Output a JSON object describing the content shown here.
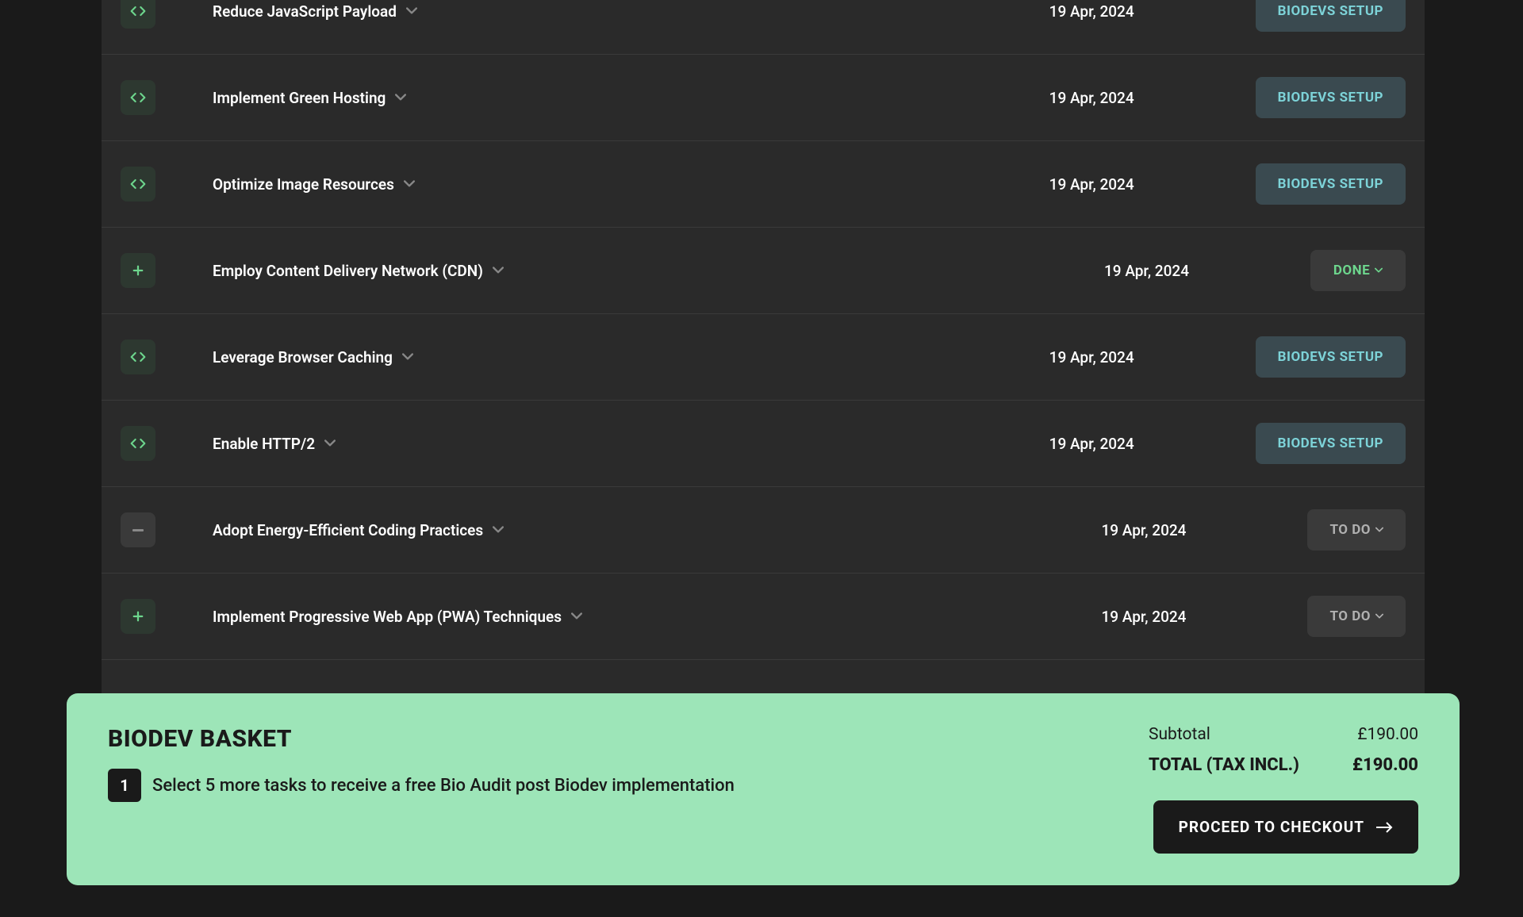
{
  "tasks": [
    {
      "title": "Reduce JavaScript Payload",
      "date": "19 Apr, 2024",
      "status": "BIODEVS SETUP",
      "statusType": "biodev",
      "iconType": "code"
    },
    {
      "title": "Implement Green Hosting",
      "date": "19 Apr, 2024",
      "status": "BIODEVS SETUP",
      "statusType": "biodev",
      "iconType": "code"
    },
    {
      "title": "Optimize Image Resources",
      "date": "19 Apr, 2024",
      "status": "BIODEVS SETUP",
      "statusType": "biodev",
      "iconType": "code"
    },
    {
      "title": "Employ Content Delivery Network (CDN)",
      "date": "19 Apr, 2024",
      "status": "DONE",
      "statusType": "done",
      "iconType": "plus"
    },
    {
      "title": "Leverage Browser Caching",
      "date": "19 Apr, 2024",
      "status": "BIODEVS SETUP",
      "statusType": "biodev",
      "iconType": "code"
    },
    {
      "title": "Enable HTTP/2",
      "date": "19 Apr, 2024",
      "status": "BIODEVS SETUP",
      "statusType": "biodev",
      "iconType": "code"
    },
    {
      "title": "Adopt Energy-Efficient Coding Practices",
      "date": "19 Apr, 2024",
      "status": "TO DO",
      "statusType": "todo",
      "iconType": "minus"
    },
    {
      "title": "Implement Progressive Web App (PWA) Techniques",
      "date": "19 Apr, 2024",
      "status": "TO DO",
      "statusType": "todo",
      "iconType": "plus"
    }
  ],
  "basket": {
    "title": "BIODEV BASKET",
    "count": "1",
    "message": "Select 5 more tasks to receive a free Bio Audit post Biodev implementation",
    "subtotalLabel": "Subtotal",
    "subtotalValue": "£190.00",
    "totalLabel": "TOTAL (TAX INCL.)",
    "totalValue": "£190.00",
    "checkoutLabel": "PROCEED TO CHECKOUT"
  }
}
